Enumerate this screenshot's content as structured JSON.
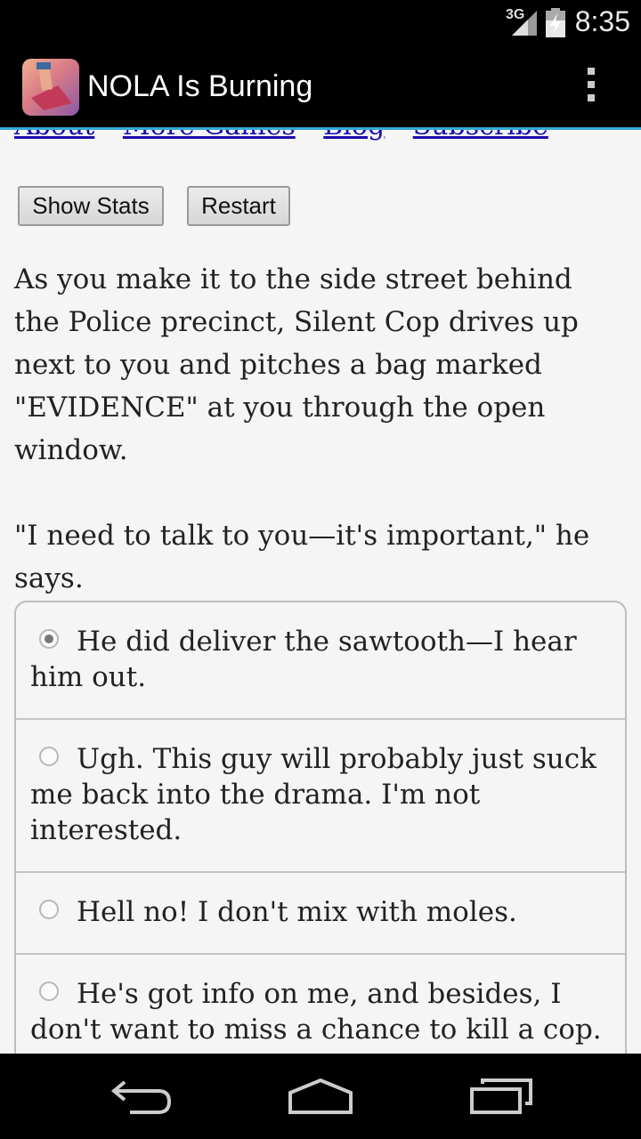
{
  "status_bar": {
    "network": "3G",
    "time": "8:35",
    "icons": [
      "signal-icon",
      "battery-charging-icon"
    ]
  },
  "action_bar": {
    "title": "NOLA Is Burning",
    "icons": [
      "app-icon",
      "overflow-menu-icon"
    ]
  },
  "links": [
    "About",
    "More Games",
    "Blog",
    "Subscribe"
  ],
  "buttons": {
    "show_stats": "Show Stats",
    "restart": "Restart"
  },
  "story": {
    "paragraph_1": "As you make it to the side street behind the Police precinct, Silent Cop drives up next to you and pitches a bag marked \"EVIDENCE\" at you through the open window.",
    "paragraph_2": "\"I need to talk to you—it's important,\" he says."
  },
  "choices": [
    {
      "label": "He did deliver the sawtooth—I hear him out.",
      "selected": true
    },
    {
      "label": "Ugh. This guy will probably just suck me back into the drama. I'm not interested.",
      "selected": false
    },
    {
      "label": "Hell no! I don't mix with moles.",
      "selected": false
    },
    {
      "label": "He's got info on me, and besides, I don't want to miss a chance to kill a cop.",
      "selected": false
    }
  ],
  "nav_bar": {
    "icons": [
      "back-icon",
      "home-icon",
      "recent-apps-icon"
    ]
  }
}
